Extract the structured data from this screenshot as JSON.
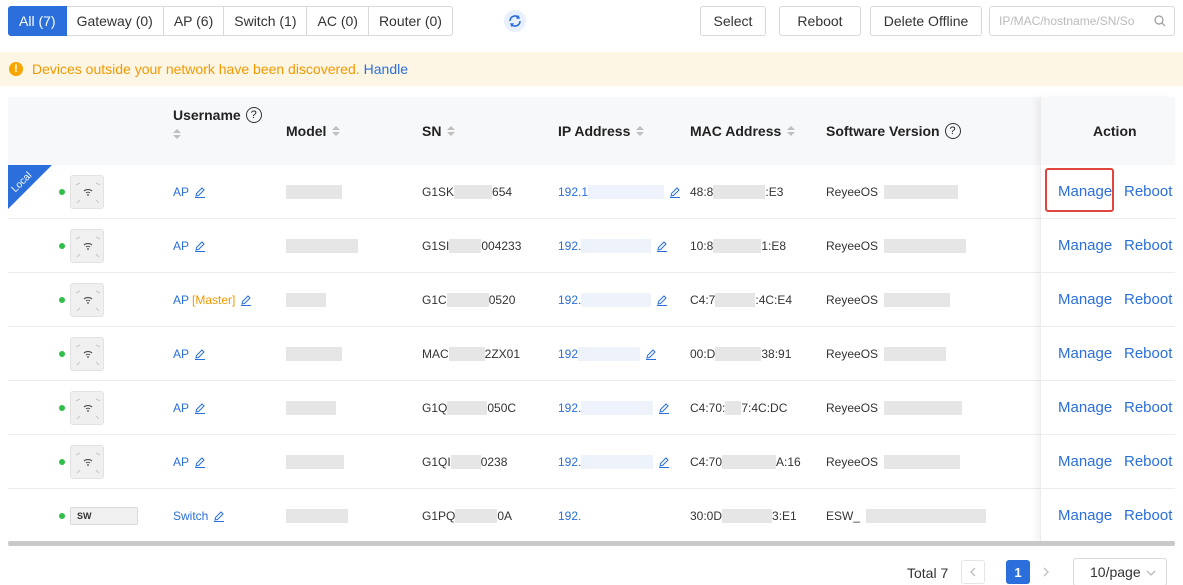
{
  "tabs": [
    {
      "label": "All (7)",
      "active": true
    },
    {
      "label": "Gateway (0)"
    },
    {
      "label": "AP (6)"
    },
    {
      "label": "Switch (1)"
    },
    {
      "label": "AC (0)"
    },
    {
      "label": "Router (0)"
    }
  ],
  "toolbar": {
    "select_label": "Select",
    "reboot_label": "Reboot",
    "delete_offline_label": "Delete Offline",
    "search_placeholder": "IP/MAC/hostname/SN/So"
  },
  "notice": {
    "icon": "!",
    "text": "Devices outside your network have been discovered.",
    "link": "Handle"
  },
  "table": {
    "columns": {
      "username": "Username",
      "model": "Model",
      "sn": "SN",
      "ip": "IP Address",
      "mac": "MAC Address",
      "software": "Software Version",
      "action": "Action"
    },
    "help_glyph": "?",
    "local_badge": "Local",
    "rows": [
      {
        "username": "AP",
        "master_tag": "",
        "sn_a": "G1SK",
        "sn_b": "654",
        "ip": "192.1",
        "mac_a": "48:8",
        "mac_b": ":E3",
        "sw": "ReyeeOS",
        "manage": "Manage",
        "reboot": "Reboot"
      },
      {
        "username": "AP",
        "master_tag": "",
        "sn_a": "G1SI",
        "sn_b": "004233",
        "ip": "192.",
        "mac_a": "10:8",
        "mac_b": "1:E8",
        "sw": "ReyeeOS",
        "manage": "Manage",
        "reboot": "Reboot"
      },
      {
        "username": "AP",
        "master_tag": "[Master]",
        "sn_a": "G1C",
        "sn_b": "0520",
        "ip": "192.",
        "mac_a": "C4:7",
        "mac_b": ":4C:E4",
        "sw": "ReyeeOS",
        "manage": "Manage",
        "reboot": "Reboot"
      },
      {
        "username": "AP",
        "master_tag": "",
        "sn_a": "MAC",
        "sn_b": "2ZX01",
        "ip": "192",
        "mac_a": "00:D",
        "mac_b": "38:91",
        "sw": "ReyeeOS",
        "manage": "Manage",
        "reboot": "Reboot"
      },
      {
        "username": "AP",
        "master_tag": "",
        "sn_a": "G1Q",
        "sn_b": "050C",
        "ip": "192.",
        "mac_a": "C4:70:",
        "mac_b": "7:4C:DC",
        "sw": "ReyeeOS",
        "manage": "Manage",
        "reboot": "Reboot"
      },
      {
        "username": "AP",
        "master_tag": "",
        "sn_a": "G1QI",
        "sn_b": "0238",
        "ip": "192.",
        "mac_a": "C4:70",
        "mac_b": "A:16",
        "sw": "ReyeeOS",
        "manage": "Manage",
        "reboot": "Reboot"
      },
      {
        "username": "Switch",
        "master_tag": "",
        "sn_a": "G1PQ",
        "sn_b": "0A",
        "ip": "192.",
        "mac_a": "30:0D",
        "mac_b": "3:E1",
        "sw": "ESW_",
        "manage": "Manage",
        "reboot": "Reboot",
        "device_label": "SW"
      }
    ]
  },
  "pagination": {
    "total": "Total 7",
    "current_page": "1",
    "page_size": "10/page"
  },
  "colors": {
    "accent": "#2a6fdb",
    "warning": "#f39800",
    "online": "#2fbf4a",
    "highlight": "#e0463b"
  }
}
